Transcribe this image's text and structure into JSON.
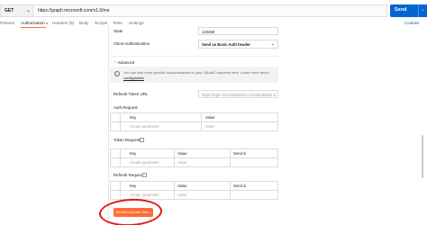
{
  "request": {
    "method": "GET",
    "url": "https://graph.microsoft.com/v1.0/me",
    "send_label": "Send"
  },
  "tabs": [
    {
      "label": "Params"
    },
    {
      "label": "Authorization"
    },
    {
      "label": "Headers (9)"
    },
    {
      "label": "Body"
    },
    {
      "label": "Scripts"
    },
    {
      "label": "Tests"
    },
    {
      "label": "Settings"
    }
  ],
  "cookies_label": "Cookies",
  "form": {
    "state_label": "State",
    "state_value": "12345E",
    "client_auth_label": "Client Authentication",
    "client_auth_value": "Send as Basic Auth header",
    "advanced_label": "Advanced",
    "info_text": "You can add more specific customizations to your OAuth2 requests here. Learn more about ",
    "info_link": "configuration",
    "refresh_url_label": "Refresh Token URL",
    "refresh_url_value": "https://login.microsoftonline.com/5fa3d931-2",
    "auth_request_label": "Auth Request",
    "token_request_label": "Token Request",
    "refresh_request_label": "Refresh Request"
  },
  "auth_table": {
    "headers": [
      "Key",
      "Value"
    ],
    "placeholders": [
      "Create parameter",
      "Value"
    ]
  },
  "token_table": {
    "headers": [
      "Key",
      "Value",
      "Send in"
    ],
    "placeholders": [
      "Create parameter",
      "Value"
    ]
  },
  "refresh_table": {
    "headers": [
      "Key",
      "Value",
      "Send in"
    ],
    "placeholders": [
      "Create parameter",
      "Value"
    ]
  },
  "get_token_label": "Get New Access Token",
  "colors": {
    "accent": "#ff6c37",
    "send_blue": "#0265d2",
    "annotation_red": "#e01818"
  }
}
